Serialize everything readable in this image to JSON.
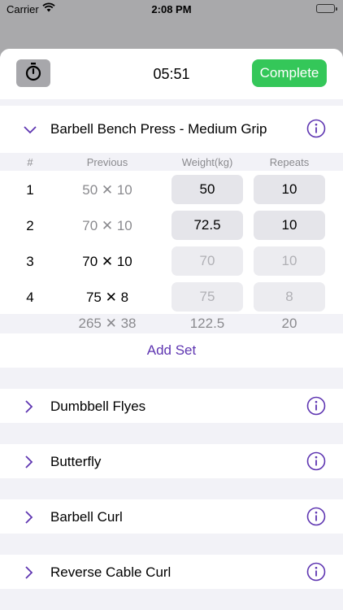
{
  "status_bar": {
    "carrier": "Carrier",
    "time": "2:08 PM"
  },
  "header": {
    "elapsed": "05:51",
    "complete_label": "Complete"
  },
  "colors": {
    "accent": "#5e35b1",
    "complete": "#34c759",
    "muted": "#8a8a8e"
  },
  "active_exercise": {
    "name": "Barbell Bench Press - Medium Grip",
    "columns": {
      "num": "#",
      "previous": "Previous",
      "weight": "Weight(kg)",
      "repeats": "Repeats"
    },
    "sets": [
      {
        "num": "1",
        "previous": "50 ✕ 10",
        "weight": "50",
        "repeats": "10"
      },
      {
        "num": "2",
        "previous": "70 ✕ 10",
        "weight": "72.5",
        "repeats": "10"
      },
      {
        "num": "3",
        "previous": "70 ✕ 10",
        "weight_placeholder": "70",
        "repeats_placeholder": "10"
      },
      {
        "num": "4",
        "previous": "75 ✕ 8",
        "weight_placeholder": "75",
        "repeats_placeholder": "8"
      }
    ],
    "totals": {
      "previous": "265 ✕ 38",
      "weight": "122.5",
      "repeats": "20"
    },
    "add_set_label": "Add Set"
  },
  "exercises": [
    {
      "name": "Dumbbell Flyes"
    },
    {
      "name": "Butterfly"
    },
    {
      "name": "Barbell Curl"
    },
    {
      "name": "Reverse Cable Curl"
    }
  ]
}
